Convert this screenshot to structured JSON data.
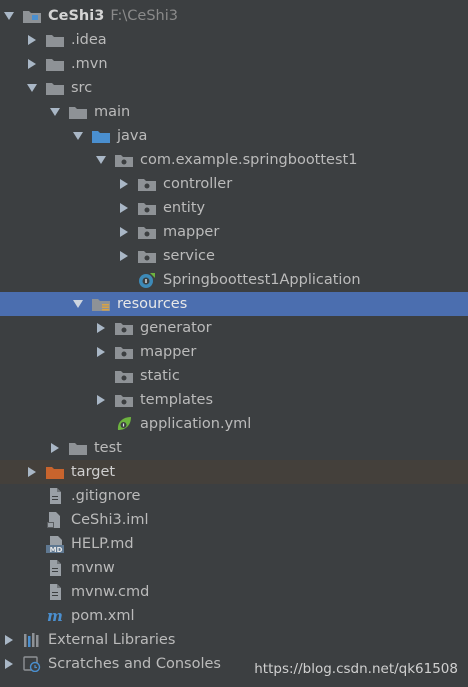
{
  "project": {
    "name": "CeShi3",
    "path": "F:\\CeShi3"
  },
  "items": [
    {
      "label": ".idea"
    },
    {
      "label": ".mvn"
    },
    {
      "label": "src"
    },
    {
      "label": "main"
    },
    {
      "label": "java"
    },
    {
      "label": "com.example.springboottest1"
    },
    {
      "label": "controller"
    },
    {
      "label": "entity"
    },
    {
      "label": "mapper"
    },
    {
      "label": "service"
    },
    {
      "label": "Springboottest1Application"
    },
    {
      "label": "resources"
    },
    {
      "label": "generator"
    },
    {
      "label": "mapper"
    },
    {
      "label": "static"
    },
    {
      "label": "templates"
    },
    {
      "label": "application.yml"
    },
    {
      "label": "test"
    },
    {
      "label": "target"
    },
    {
      "label": ".gitignore"
    },
    {
      "label": "CeShi3.iml"
    },
    {
      "label": "HELP.md"
    },
    {
      "label": "mvnw"
    },
    {
      "label": "mvnw.cmd"
    },
    {
      "label": "pom.xml"
    },
    {
      "label": "External Libraries"
    },
    {
      "label": "Scratches and Consoles"
    }
  ],
  "watermark": "https://blog.csdn.net/qk61508",
  "icons": {
    "md_badge": "MD",
    "maven": "m"
  },
  "colors": {
    "background": "#3c3f41",
    "selection": "#4b6eaf",
    "folder": "#8e9296",
    "source_folder": "#4a8fcf",
    "excluded_folder": "#c8642d",
    "spring_green": "#6db33f"
  }
}
